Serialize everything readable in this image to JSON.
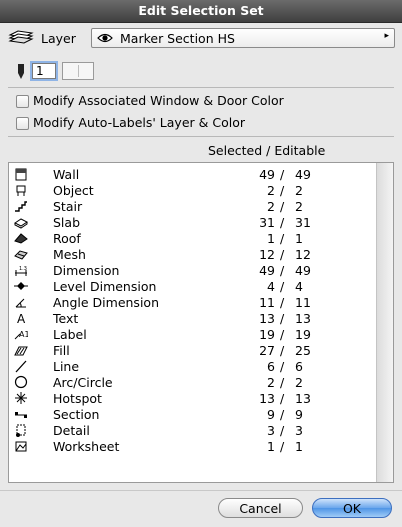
{
  "window": {
    "title": "Edit Selection Set"
  },
  "layer": {
    "label": "Layer",
    "value": "Marker Section HS",
    "arrow": "▸"
  },
  "pen": {
    "value": "1"
  },
  "options": [
    {
      "label": "Modify Associated Window & Door Color",
      "checked": false
    },
    {
      "label": "Modify Auto-Labels' Layer & Color",
      "checked": false
    }
  ],
  "list": {
    "header": "Selected / Editable",
    "items": [
      {
        "name": "Wall",
        "selected": "49",
        "editable": "49",
        "icon": "wall-icon"
      },
      {
        "name": "Object",
        "selected": "2",
        "editable": "2",
        "icon": "object-icon"
      },
      {
        "name": "Stair",
        "selected": "2",
        "editable": "2",
        "icon": "stair-icon"
      },
      {
        "name": "Slab",
        "selected": "31",
        "editable": "31",
        "icon": "slab-icon"
      },
      {
        "name": "Roof",
        "selected": "1",
        "editable": "1",
        "icon": "roof-icon"
      },
      {
        "name": "Mesh",
        "selected": "12",
        "editable": "12",
        "icon": "mesh-icon"
      },
      {
        "name": "Dimension",
        "selected": "49",
        "editable": "49",
        "icon": "dimension-icon"
      },
      {
        "name": "Level Dimension",
        "selected": "4",
        "editable": "4",
        "icon": "level-dimension-icon"
      },
      {
        "name": "Angle Dimension",
        "selected": "11",
        "editable": "11",
        "icon": "angle-dimension-icon"
      },
      {
        "name": "Text",
        "selected": "13",
        "editable": "13",
        "icon": "text-icon"
      },
      {
        "name": "Label",
        "selected": "19",
        "editable": "19",
        "icon": "label-icon"
      },
      {
        "name": "Fill",
        "selected": "27",
        "editable": "25",
        "icon": "fill-icon"
      },
      {
        "name": "Line",
        "selected": "6",
        "editable": "6",
        "icon": "line-icon"
      },
      {
        "name": "Arc/Circle",
        "selected": "2",
        "editable": "2",
        "icon": "arc-circle-icon"
      },
      {
        "name": "Hotspot",
        "selected": "13",
        "editable": "13",
        "icon": "hotspot-icon"
      },
      {
        "name": "Section",
        "selected": "9",
        "editable": "9",
        "icon": "section-icon"
      },
      {
        "name": "Detail",
        "selected": "3",
        "editable": "3",
        "icon": "detail-icon"
      },
      {
        "name": "Worksheet",
        "selected": "1",
        "editable": "1",
        "icon": "worksheet-icon"
      }
    ]
  },
  "buttons": {
    "cancel": "Cancel",
    "ok": "OK"
  }
}
